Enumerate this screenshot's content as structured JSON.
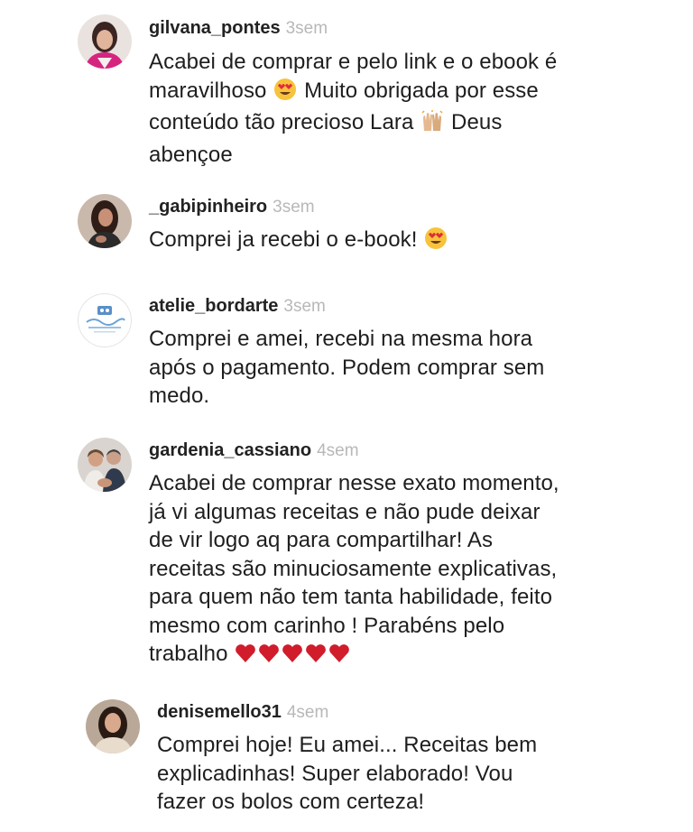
{
  "colors": {
    "text": "#1e1e1e",
    "username": "#222222",
    "timestamp": "#b8b8b8",
    "heart": "#d01c2b",
    "emoji_face": "#f7c33b"
  },
  "comments": [
    {
      "username": "gilvana_pontes",
      "time": "3sem",
      "lines": [
        "Acabei de comprar e pelo link e o ebook é",
        "maravilhoso",
        "Muito obrigada por esse",
        "conteúdo tão precioso Lara",
        "Deus",
        "abençoe"
      ]
    },
    {
      "username": "_gabipinheiro",
      "time": "3sem",
      "lines": [
        "Comprei ja recebi o e-book!"
      ]
    },
    {
      "username": "atelie_bordarte",
      "time": "3sem",
      "lines": [
        "Comprei e amei, recebi na mesma hora",
        "após o pagamento. Podem comprar sem",
        "medo."
      ]
    },
    {
      "username": "gardenia_cassiano",
      "time": "4sem",
      "lines": [
        "Acabei de comprar nesse exato momento,",
        "já vi algumas receitas e não pude deixar",
        "de vir logo aq para compartilhar! As",
        "receitas são minuciosamente explicativas,",
        "para quem não tem tanta habilidade, feito",
        "mesmo com carinho ! Parabéns pelo",
        "trabalho"
      ]
    },
    {
      "username": "denisemello31",
      "time": "4sem",
      "lines": [
        "Comprei hoje! Eu amei... Receitas bem",
        "explicadinhas! Super elaborado! Vou",
        "fazer os bolos com certeza!"
      ]
    }
  ]
}
